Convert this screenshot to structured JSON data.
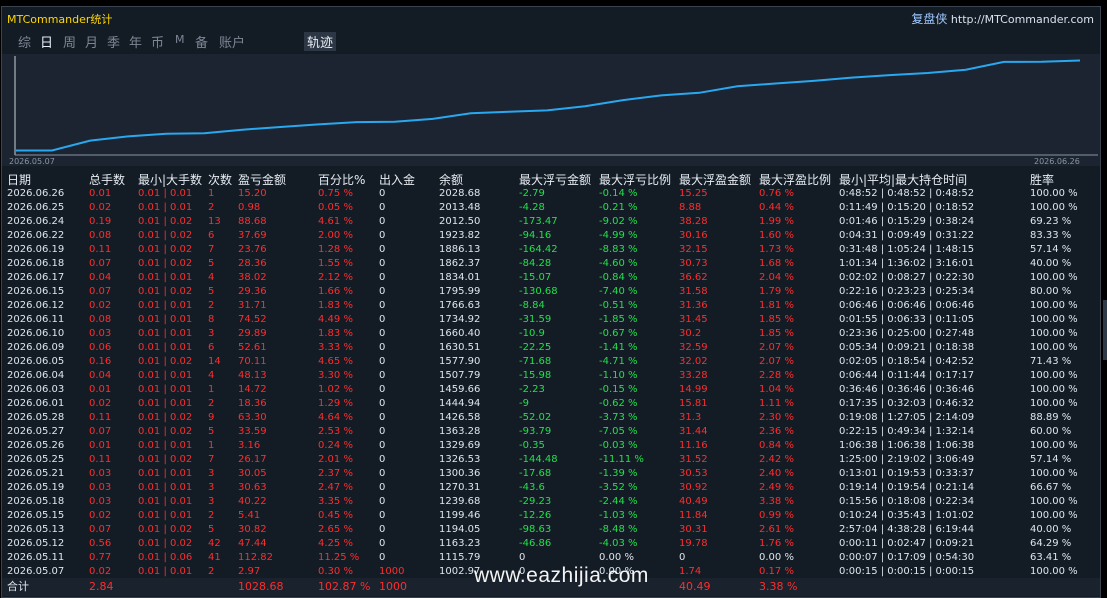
{
  "app": {
    "title": "MTCommander统计",
    "brand_cn": "复盘侠",
    "brand_url": "http://MTCommander.com"
  },
  "tabs": [
    {
      "label": "综",
      "active": false
    },
    {
      "label": "日",
      "active": true
    },
    {
      "label": "周",
      "active": false
    },
    {
      "label": "月",
      "active": false
    },
    {
      "label": "季",
      "active": false
    },
    {
      "label": "年",
      "active": false
    },
    {
      "label": "币",
      "active": false
    },
    {
      "label": "M",
      "active": false
    },
    {
      "label": "备",
      "active": false
    },
    {
      "label": "账户",
      "active": false
    },
    {
      "label": "轨迹",
      "active": false
    }
  ],
  "chart_data": {
    "type": "line",
    "start_label": "2026.05.07",
    "end_label": "2026.06.26",
    "y": [
      1002.97,
      1115.79,
      1163.23,
      1194.05,
      1199.46,
      1239.68,
      1270.31,
      1300.36,
      1326.53,
      1329.69,
      1363.28,
      1426.58,
      1444.94,
      1459.66,
      1507.79,
      1577.9,
      1630.51,
      1660.4,
      1734.92,
      1766.63,
      1795.99,
      1834.01,
      1862.37,
      1886.13,
      1923.82,
      2012.5,
      2013.48,
      2028.68
    ],
    "color": "#29a8f0",
    "grid": false
  },
  "table": {
    "headers": [
      "日期",
      "总手数",
      "最小|大手数",
      "次数",
      "盈亏金额",
      "百分比%",
      "出入金",
      "余额",
      "最大浮亏金额",
      "最大浮亏比例",
      "最大浮盈金额",
      "最大浮盈比例",
      "最小|平均|最大持仓时间",
      "胜率"
    ],
    "rows": [
      [
        "2026.06.26",
        "0.01",
        "0.01 | 0.01",
        "1",
        "15.20",
        "0.75 %",
        "0",
        "2028.68",
        "-2.79",
        "-0.14 %",
        "15.25",
        "0.76 %",
        "0:48:52 | 0:48:52 | 0:48:52",
        "100.00 %"
      ],
      [
        "2026.06.25",
        "0.02",
        "0.01 | 0.01",
        "2",
        "0.98",
        "0.05 %",
        "0",
        "2013.48",
        "-4.28",
        "-0.21 %",
        "8.88",
        "0.44 %",
        "0:11:49 | 0:15:20 | 0:18:52",
        "100.00 %"
      ],
      [
        "2026.06.24",
        "0.19",
        "0.01 | 0.02",
        "13",
        "88.68",
        "4.61 %",
        "0",
        "2012.50",
        "-173.47",
        "-9.02 %",
        "38.28",
        "1.99 %",
        "0:01:46 | 0:15:29 | 0:38:24",
        "69.23 %"
      ],
      [
        "2026.06.22",
        "0.08",
        "0.01 | 0.02",
        "6",
        "37.69",
        "2.00 %",
        "0",
        "1923.82",
        "-94.16",
        "-4.99 %",
        "30.16",
        "1.60 %",
        "0:04:31 | 0:09:49 | 0:31:22",
        "83.33 %"
      ],
      [
        "2026.06.19",
        "0.11",
        "0.01 | 0.02",
        "7",
        "23.76",
        "1.28 %",
        "0",
        "1886.13",
        "-164.42",
        "-8.83 %",
        "32.15",
        "1.73 %",
        "0:31:48 | 1:05:24 | 1:48:15",
        "57.14 %"
      ],
      [
        "2026.06.18",
        "0.07",
        "0.01 | 0.02",
        "5",
        "28.36",
        "1.55 %",
        "0",
        "1862.37",
        "-84.28",
        "-4.60 %",
        "30.73",
        "1.68 %",
        "1:01:34 | 1:36:02 | 3:16:01",
        "40.00 %"
      ],
      [
        "2026.06.17",
        "0.04",
        "0.01 | 0.01",
        "4",
        "38.02",
        "2.12 %",
        "0",
        "1834.01",
        "-15.07",
        "-0.84 %",
        "36.62",
        "2.04 %",
        "0:02:02 | 0:08:27 | 0:22:30",
        "100.00 %"
      ],
      [
        "2026.06.15",
        "0.07",
        "0.01 | 0.02",
        "5",
        "29.36",
        "1.66 %",
        "0",
        "1795.99",
        "-130.68",
        "-7.40 %",
        "31.58",
        "1.79 %",
        "0:22:16 | 0:23:23 | 0:25:34",
        "80.00 %"
      ],
      [
        "2026.06.12",
        "0.02",
        "0.01 | 0.01",
        "2",
        "31.71",
        "1.83 %",
        "0",
        "1766.63",
        "-8.84",
        "-0.51 %",
        "31.36",
        "1.81 %",
        "0:06:46 | 0:06:46 | 0:06:46",
        "100.00 %"
      ],
      [
        "2026.06.11",
        "0.08",
        "0.01 | 0.01",
        "8",
        "74.52",
        "4.49 %",
        "0",
        "1734.92",
        "-31.59",
        "-1.85 %",
        "31.45",
        "1.85 %",
        "0:01:55 | 0:06:33 | 0:11:05",
        "100.00 %"
      ],
      [
        "2026.06.10",
        "0.03",
        "0.01 | 0.01",
        "3",
        "29.89",
        "1.83 %",
        "0",
        "1660.40",
        "-10.9",
        "-0.67 %",
        "30.2",
        "1.85 %",
        "0:23:36 | 0:25:00 | 0:27:48",
        "100.00 %"
      ],
      [
        "2026.06.09",
        "0.06",
        "0.01 | 0.01",
        "6",
        "52.61",
        "3.33 %",
        "0",
        "1630.51",
        "-22.25",
        "-1.41 %",
        "32.59",
        "2.07 %",
        "0:05:34 | 0:09:21 | 0:18:38",
        "100.00 %"
      ],
      [
        "2026.06.05",
        "0.16",
        "0.01 | 0.02",
        "14",
        "70.11",
        "4.65 %",
        "0",
        "1577.90",
        "-71.68",
        "-4.71 %",
        "32.02",
        "2.07 %",
        "0:02:05 | 0:18:54 | 0:42:52",
        "71.43 %"
      ],
      [
        "2026.06.04",
        "0.04",
        "0.01 | 0.01",
        "4",
        "48.13",
        "3.30 %",
        "0",
        "1507.79",
        "-15.98",
        "-1.10 %",
        "33.28",
        "2.28 %",
        "0:06:44 | 0:11:44 | 0:17:17",
        "100.00 %"
      ],
      [
        "2026.06.03",
        "0.01",
        "0.01 | 0.01",
        "1",
        "14.72",
        "1.02 %",
        "0",
        "1459.66",
        "-2.23",
        "-0.15 %",
        "14.99",
        "1.04 %",
        "0:36:46 | 0:36:46 | 0:36:46",
        "100.00 %"
      ],
      [
        "2026.06.01",
        "0.02",
        "0.01 | 0.01",
        "2",
        "18.36",
        "1.29 %",
        "0",
        "1444.94",
        "-9",
        "-0.62 %",
        "15.81",
        "1.11 %",
        "0:17:35 | 0:32:03 | 0:46:32",
        "100.00 %"
      ],
      [
        "2026.05.28",
        "0.11",
        "0.01 | 0.02",
        "9",
        "63.30",
        "4.64 %",
        "0",
        "1426.58",
        "-52.02",
        "-3.73 %",
        "31.3",
        "2.30 %",
        "0:19:08 | 1:27:05 | 2:14:09",
        "88.89 %"
      ],
      [
        "2026.05.27",
        "0.07",
        "0.01 | 0.02",
        "5",
        "33.59",
        "2.53 %",
        "0",
        "1363.28",
        "-93.79",
        "-7.05 %",
        "31.44",
        "2.36 %",
        "0:22:15 | 0:49:34 | 1:32:14",
        "60.00 %"
      ],
      [
        "2026.05.26",
        "0.01",
        "0.01 | 0.01",
        "1",
        "3.16",
        "0.24 %",
        "0",
        "1329.69",
        "-0.35",
        "-0.03 %",
        "11.16",
        "0.84 %",
        "1:06:38 | 1:06:38 | 1:06:38",
        "100.00 %"
      ],
      [
        "2026.05.25",
        "0.11",
        "0.01 | 0.02",
        "7",
        "26.17",
        "2.01 %",
        "0",
        "1326.53",
        "-144.48",
        "-11.11 %",
        "31.52",
        "2.42 %",
        "1:25:00 | 2:19:02 | 3:06:49",
        "57.14 %"
      ],
      [
        "2026.05.21",
        "0.03",
        "0.01 | 0.01",
        "3",
        "30.05",
        "2.37 %",
        "0",
        "1300.36",
        "-17.68",
        "-1.39 %",
        "30.53",
        "2.40 %",
        "0:13:01 | 0:19:53 | 0:33:37",
        "100.00 %"
      ],
      [
        "2026.05.19",
        "0.03",
        "0.01 | 0.01",
        "3",
        "30.63",
        "2.47 %",
        "0",
        "1270.31",
        "-43.6",
        "-3.52 %",
        "30.92",
        "2.49 %",
        "0:19:14 | 0:19:54 | 0:21:14",
        "66.67 %"
      ],
      [
        "2026.05.18",
        "0.03",
        "0.01 | 0.01",
        "3",
        "40.22",
        "3.35 %",
        "0",
        "1239.68",
        "-29.23",
        "-2.44 %",
        "40.49",
        "3.38 %",
        "0:15:56 | 0:18:08 | 0:22:34",
        "100.00 %"
      ],
      [
        "2026.05.15",
        "0.02",
        "0.01 | 0.01",
        "2",
        "5.41",
        "0.45 %",
        "0",
        "1199.46",
        "-12.26",
        "-1.03 %",
        "11.84",
        "0.99 %",
        "0:10:24 | 0:35:43 | 1:01:02",
        "100.00 %"
      ],
      [
        "2026.05.13",
        "0.07",
        "0.01 | 0.02",
        "5",
        "30.82",
        "2.65 %",
        "0",
        "1194.05",
        "-98.63",
        "-8.48 %",
        "30.31",
        "2.61 %",
        "2:57:04 | 4:38:28 | 6:19:44",
        "40.00 %"
      ],
      [
        "2026.05.12",
        "0.56",
        "0.01 | 0.02",
        "42",
        "47.44",
        "4.25 %",
        "0",
        "1163.23",
        "-46.86",
        "-4.03 %",
        "19.78",
        "1.76 %",
        "0:00:11 | 0:02:47 | 0:09:21",
        "64.29 %"
      ],
      [
        "2026.05.11",
        "0.77",
        "0.01 | 0.06",
        "41",
        "112.82",
        "11.25 %",
        "0",
        "1115.79",
        "0",
        "0.00 %",
        "0",
        "0.00 %",
        "0:00:07 | 0:17:09 | 0:54:30",
        "63.41 %"
      ],
      [
        "2026.05.07",
        "0.02",
        "0.01 | 0.01",
        "2",
        "2.97",
        "0.30 %",
        "1000",
        "1002.97",
        "0",
        "0.00 %",
        "1.74",
        "0.17 %",
        "0:00:15 | 0:00:15 | 0:00:15",
        "100.00 %"
      ]
    ],
    "totals": {
      "label": "合计",
      "lots": "2.84",
      "pnl": "1028.68",
      "pct": "102.87 %",
      "deposit": "1000",
      "max_float_profit": "40.49",
      "max_float_profit_pct": "3.38 %"
    }
  },
  "watermark": "www.eazhijia.com"
}
